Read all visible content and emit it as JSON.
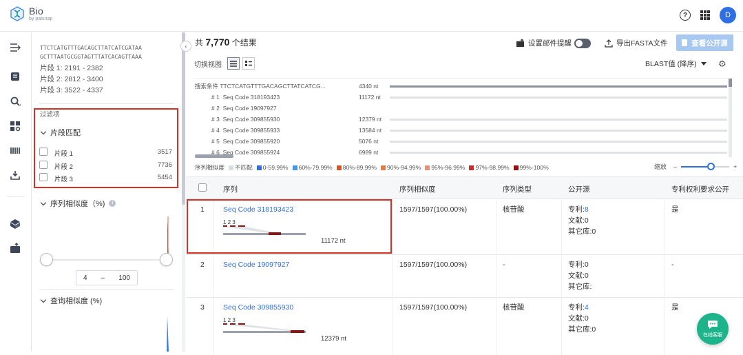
{
  "app": {
    "name": "Bio",
    "byline": "by patsnap",
    "avatar_letter": "D"
  },
  "query": {
    "sequence_line1": "TTCTCATGTTTGACAGCTTATCATCGATAA",
    "sequence_line2": "GCTTTAATGCGGTAGTTTATCACAGTTAAA",
    "fragments": [
      "片段 1:  2191 - 2382",
      "片段 2:  2812 - 3400",
      "片段 3:  3522 - 4337"
    ]
  },
  "filters": {
    "label": "过滤项",
    "fragment_match": {
      "title": "片段匹配",
      "items": [
        {
          "label": "片段 1",
          "count": "3517"
        },
        {
          "label": "片段 2",
          "count": "7736"
        },
        {
          "label": "片段 3",
          "count": "5454"
        }
      ]
    },
    "seq_similarity": {
      "title": "序列相似度（%)",
      "min": "4",
      "dash": "–",
      "max": "100"
    },
    "query_similarity": {
      "title": "查询相似度 (%)"
    }
  },
  "results": {
    "prefix": "共",
    "count": "7,770",
    "suffix": "个结果",
    "email_alert": "设置邮件提醒",
    "export_fasta": "导出FASTA文件",
    "view_public": "查看公开源",
    "switch_view": "切换视图",
    "sort_by": "BLAST值 (降序)"
  },
  "overview": {
    "query_label": "搜索条件  TTCTCATGTTTGACAGCTTATCATCG...",
    "query_len": "4340 nt",
    "rows": [
      {
        "idx": "# 1",
        "name": "Seq Code 318193423",
        "len": "11172 nt"
      },
      {
        "idx": "# 2",
        "name": "Seq Code 19097927",
        "len": ""
      },
      {
        "idx": "# 3",
        "name": "Seq Code 309855930",
        "len": "12379 nt"
      },
      {
        "idx": "# 4",
        "name": "Seq Code 309855933",
        "len": "13584 nt"
      },
      {
        "idx": "# 5",
        "name": "Seq Code 309855920",
        "len": "5076 nt"
      },
      {
        "idx": "# 6",
        "name": "Seq Code 309855924",
        "len": "6989 nt"
      }
    ]
  },
  "legend": {
    "title": "序列相似度",
    "items": [
      {
        "label": "不匹配",
        "color": "#d9dce1"
      },
      {
        "label": "0-59.99%",
        "color": "#2f6fe4"
      },
      {
        "label": "60%-79.99%",
        "color": "#3b9be8"
      },
      {
        "label": "80%-89.99%",
        "color": "#d9531e"
      },
      {
        "label": "90%-94.99%",
        "color": "#e8793e"
      },
      {
        "label": "95%-96.99%",
        "color": "#e88f7a"
      },
      {
        "label": "97%-98.99%",
        "color": "#d02c2c"
      },
      {
        "label": "99%-100%",
        "color": "#8e1414"
      }
    ],
    "zoom_label": "缩放",
    "zoom_minus": "–",
    "zoom_plus": "+"
  },
  "table": {
    "headers": [
      "序列",
      "序列相似度",
      "序列类型",
      "公开源",
      "专利权利要求公开"
    ],
    "rows": [
      {
        "num": "1",
        "name": "Seq Code 318193423",
        "marks": "1  2    3",
        "length": "11172 nt",
        "similarity": "1597/1597(100.00%)",
        "type": "核苷酸",
        "patent_label": "专利:",
        "patent_val": "8",
        "lit": "文献:0",
        "other": "其它库:0",
        "claim": "是"
      },
      {
        "num": "2",
        "name": "Seq Code 19097927",
        "marks": "",
        "length": "",
        "similarity": "1597/1597(100.00%)",
        "type": "-",
        "patent_label": "专利:",
        "patent_val": "0",
        "lit": "文献:0",
        "other": "其它库:",
        "claim": "-"
      },
      {
        "num": "3",
        "name": "Seq Code 309855930",
        "marks": "1  2    3",
        "length": "12379 nt",
        "similarity": "1597/1597(100.00%)",
        "type": "核苷酸",
        "patent_label": "专利:",
        "patent_val": "4",
        "lit": "文献:0",
        "other": "其它库:0",
        "claim": "是"
      }
    ]
  },
  "chat": {
    "label": "在线客服"
  }
}
